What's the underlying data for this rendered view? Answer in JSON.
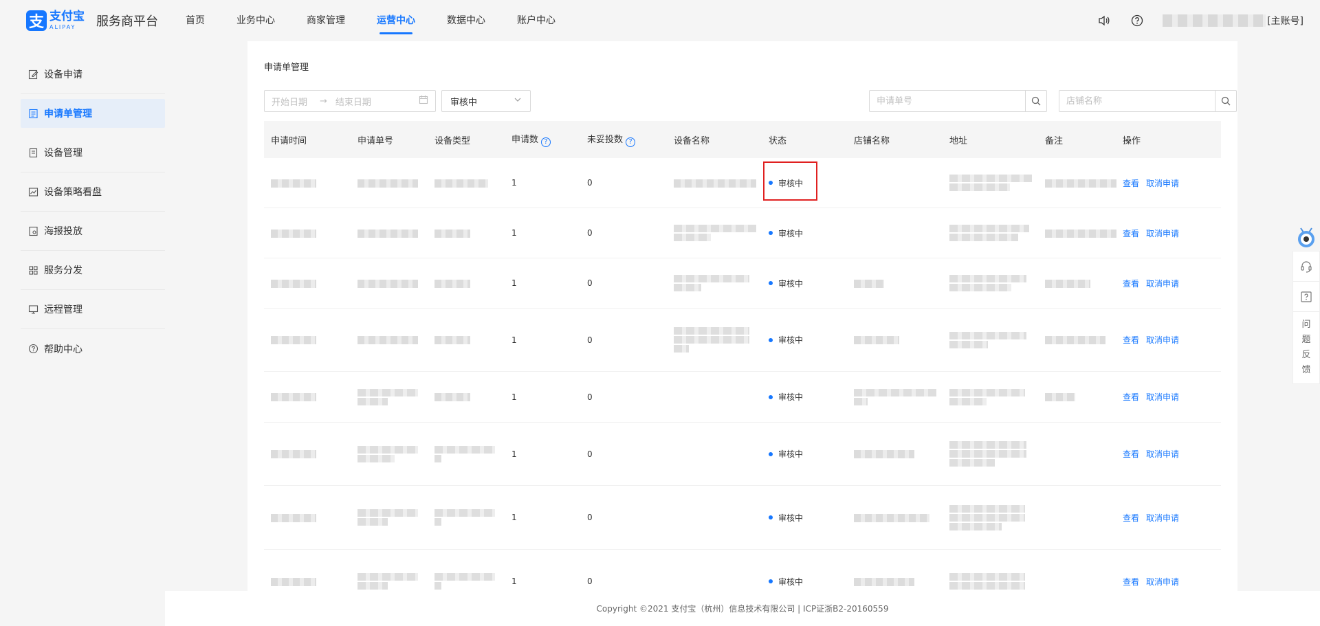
{
  "header": {
    "logo_cn": "支付宝",
    "logo_en": "ALIPAY",
    "logo_mark": "支",
    "platform": "服务商平台",
    "nav": [
      {
        "label": "首页",
        "active": false
      },
      {
        "label": "业务中心",
        "active": false
      },
      {
        "label": "商家管理",
        "active": false
      },
      {
        "label": "运营中心",
        "active": true
      },
      {
        "label": "数据中心",
        "active": false
      },
      {
        "label": "账户中心",
        "active": false
      }
    ],
    "account_suffix": "[主账号]"
  },
  "sidebar": {
    "items": [
      {
        "label": "设备申请",
        "icon": "edit-icon",
        "active": false
      },
      {
        "label": "申请单管理",
        "icon": "document-icon",
        "active": true
      },
      {
        "label": "设备管理",
        "icon": "device-list-icon",
        "active": false
      },
      {
        "label": "设备策略看盘",
        "icon": "chart-icon",
        "active": false
      },
      {
        "label": "海报投放",
        "icon": "poster-icon",
        "active": false
      },
      {
        "label": "服务分发",
        "icon": "grid-icon",
        "active": false
      },
      {
        "label": "远程管理",
        "icon": "monitor-icon",
        "active": false
      },
      {
        "label": "帮助中心",
        "icon": "help-icon",
        "active": false
      }
    ]
  },
  "main": {
    "title": "申请单管理",
    "filters": {
      "start_placeholder": "开始日期",
      "end_placeholder": "结束日期",
      "status_value": "审核中",
      "order_no_placeholder": "申请单号",
      "store_placeholder": "店铺名称"
    },
    "columns": [
      "申请时间",
      "申请单号",
      "设备类型",
      "申请数",
      "未妥投数",
      "设备名称",
      "状态",
      "店铺名称",
      "地址",
      "备注",
      "操作"
    ],
    "rows": [
      {
        "count": "1",
        "undelivered": "0",
        "status": "审核中",
        "view": "查看",
        "cancel": "取消申请"
      },
      {
        "count": "1",
        "undelivered": "0",
        "status": "审核中",
        "view": "查看",
        "cancel": "取消申请"
      },
      {
        "count": "1",
        "undelivered": "0",
        "status": "审核中",
        "view": "查看",
        "cancel": "取消申请"
      },
      {
        "count": "1",
        "undelivered": "0",
        "status": "审核中",
        "view": "查看",
        "cancel": "取消申请"
      },
      {
        "count": "1",
        "undelivered": "0",
        "status": "审核中",
        "view": "查看",
        "cancel": "取消申请"
      },
      {
        "count": "1",
        "undelivered": "0",
        "status": "审核中",
        "view": "查看",
        "cancel": "取消申请"
      },
      {
        "count": "1",
        "undelivered": "0",
        "status": "审核中",
        "view": "查看",
        "cancel": "取消申请"
      },
      {
        "count": "1",
        "undelivered": "0",
        "status": "审核中",
        "view": "查看",
        "cancel": "取消申请"
      }
    ]
  },
  "footer": {
    "text": "Copyright ©2021 支付宝（杭州）信息技术有限公司 | ICP证浙B2-20160559"
  },
  "float": {
    "feedback": [
      "问",
      "题",
      "反",
      "馈"
    ]
  },
  "colors": {
    "accent": "#1677ff",
    "highlight": "#e02020"
  }
}
